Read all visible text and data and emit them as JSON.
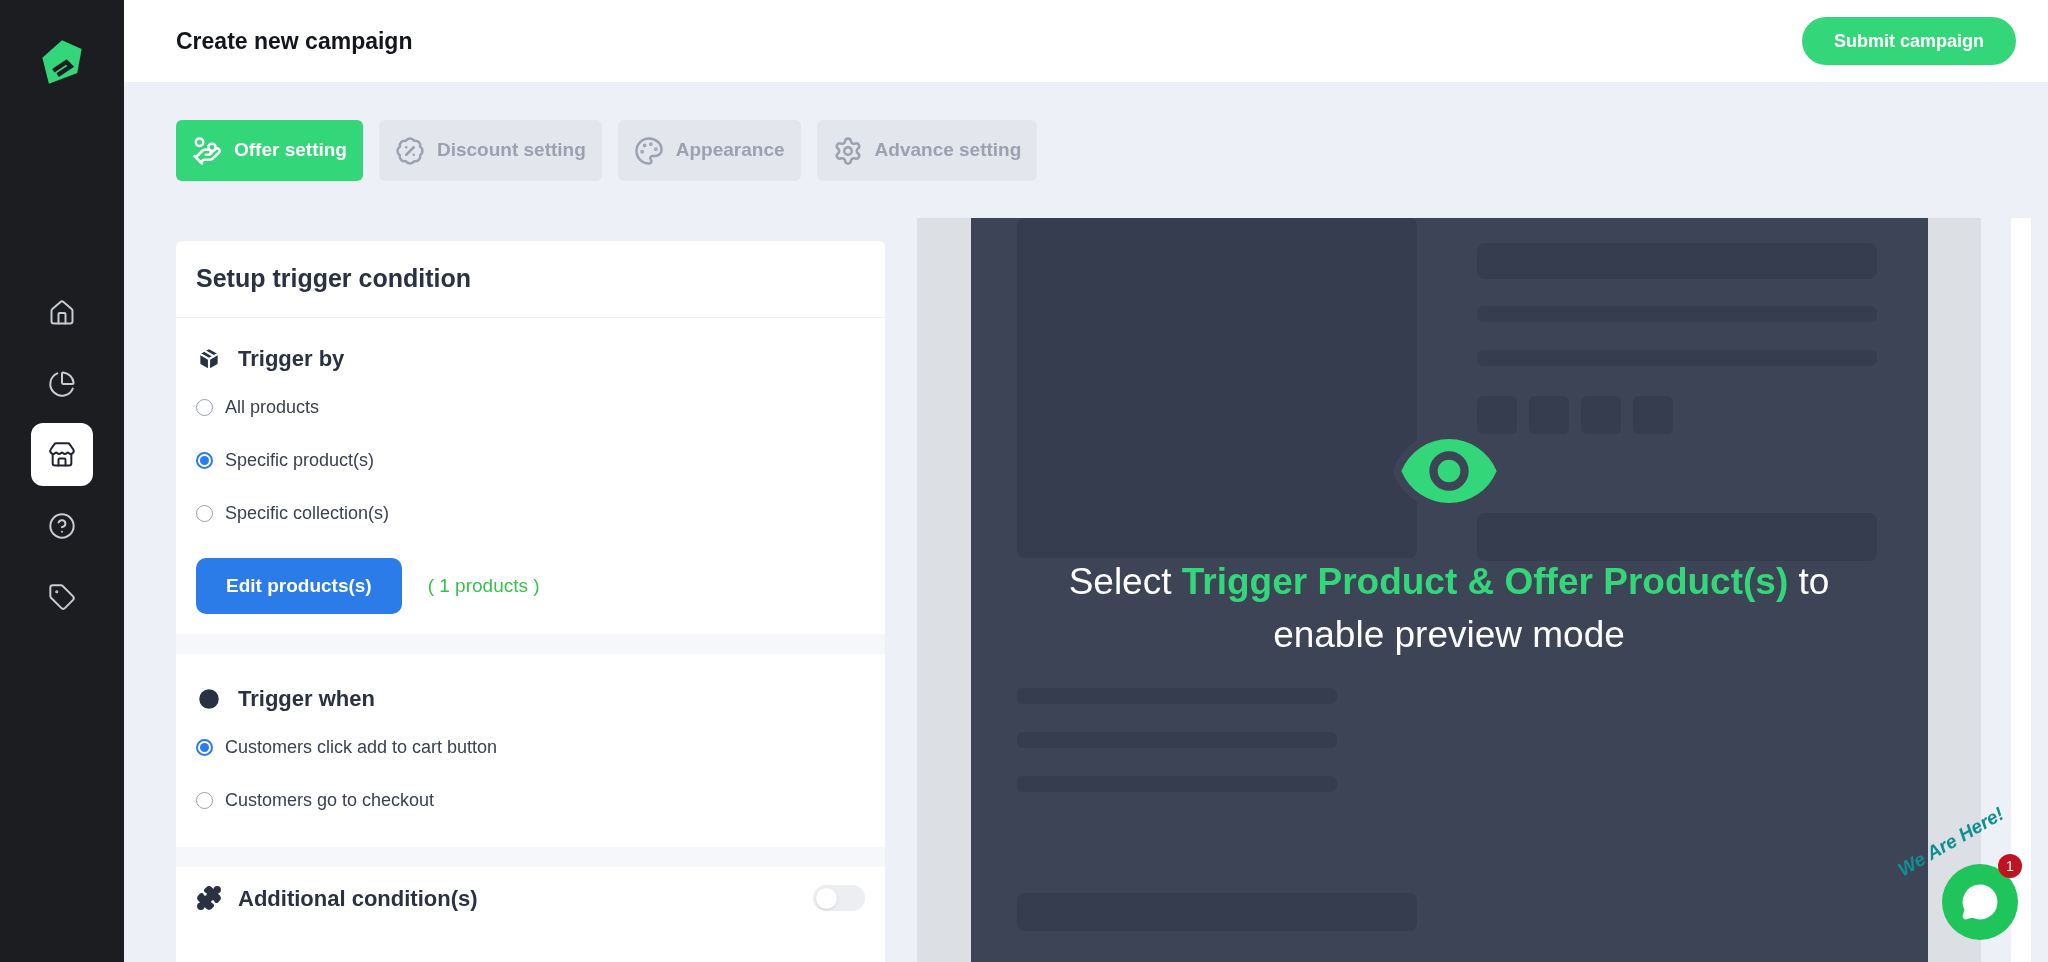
{
  "sidebar": {
    "items": [
      {
        "selected": false
      },
      {
        "selected": false
      },
      {
        "selected": true
      },
      {
        "selected": false
      },
      {
        "selected": false
      }
    ]
  },
  "header": {
    "title": "Create new campaign",
    "submit_button": "Submit campaign"
  },
  "tabs": [
    {
      "label": "Offer setting",
      "selected": true
    },
    {
      "label": "Discount setting",
      "selected": false
    },
    {
      "label": "Appearance",
      "selected": false
    },
    {
      "label": "Advance setting",
      "selected": false
    }
  ],
  "card": {
    "title": "Setup trigger condition",
    "trigger_by": {
      "heading": "Trigger by",
      "options": [
        {
          "label": "All products",
          "selected": false
        },
        {
          "label": "Specific product(s)",
          "selected": true
        },
        {
          "label": "Specific collection(s)",
          "selected": false
        }
      ],
      "edit_button": "Edit products(s)",
      "count": "( 1 products )"
    },
    "trigger_when": {
      "heading": "Trigger when",
      "options": [
        {
          "label": "Customers click add to cart button",
          "selected": true
        },
        {
          "label": "Customers go to checkout",
          "selected": false
        }
      ]
    },
    "additional": {
      "heading": "Additional condition(s)",
      "on": false
    }
  },
  "preview": {
    "message_start": "Select ",
    "message_highlight": "Trigger Product & Offer Product(s)",
    "message_end": " to enable preview mode"
  },
  "chat_widget": {
    "tagline": "We Are Here!",
    "badge": "1"
  }
}
